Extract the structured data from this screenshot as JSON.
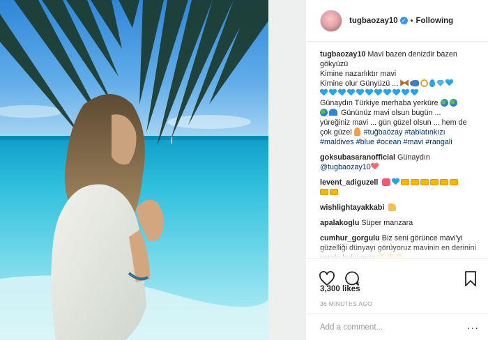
{
  "post": {
    "username": "tugbaozay10",
    "follow_status": "Following",
    "likes": "3,300 likes",
    "time_ago": "36 MINUTES AGO",
    "comment_placeholder": "Add a comment..."
  },
  "caption": {
    "username": "tugbaozay10",
    "line1": "Mavi bazen denizdir bazen gökyüzü",
    "line2": "Kimine nazarlıktır mavi",
    "line3": "Kimine olur Günyüzü ...",
    "line4": "Günaydın Türkiye merhaba yerküre",
    "line5": "Gününüz mavi olsun bugün ...",
    "line6": "yüreğiniz mavi ... gün güzel olsun ... hem de çok güzel",
    "hashtags": "#tuğbaözay #tabiatınkızı #maldives #blue #ocean #mavi #rangali"
  },
  "comments": [
    {
      "user": "goksubasaranofficial",
      "text": "Günaydın",
      "mention": "@tugbaozay10"
    },
    {
      "user": "levent_adiguzell",
      "text": ""
    },
    {
      "user": "wishlightayakkabi",
      "text": ""
    },
    {
      "user": "apalakoglu",
      "text": "Süper manzara"
    },
    {
      "user": "cumhur_gorgulu",
      "text": "Biz seni görünce mavi'yi güzelliği dünyayı görüyoruz mavinin en derinini sende buluyoruz"
    }
  ],
  "icons": {
    "like": "heart-outline-icon",
    "comment": "comment-bubble-icon",
    "save": "bookmark-icon",
    "verified": "verified-badge-icon",
    "more": "ellipsis-icon"
  },
  "colors": {
    "text": "#262626",
    "link": "#003569",
    "muted": "#999999",
    "verified": "#3897f0",
    "border": "#efefef"
  }
}
